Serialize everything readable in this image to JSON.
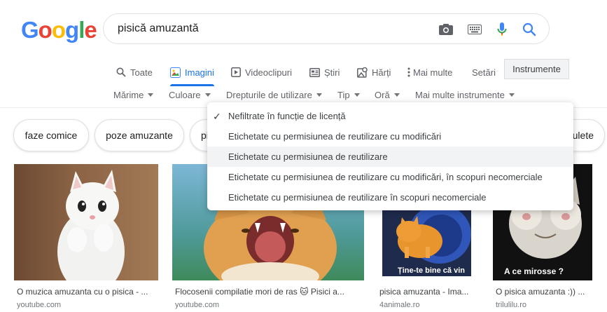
{
  "logo": {
    "letters": [
      "G",
      "o",
      "o",
      "g",
      "l",
      "e"
    ],
    "colors": [
      "#4285F4",
      "#EA4335",
      "#FBBC05",
      "#4285F4",
      "#34A853",
      "#EA4335"
    ]
  },
  "search": {
    "query": "pisică amuzantă"
  },
  "tabs": [
    {
      "label": "Toate",
      "icon": "search-icon"
    },
    {
      "label": "Imagini",
      "icon": "image-icon",
      "active": true
    },
    {
      "label": "Videoclipuri",
      "icon": "play-icon"
    },
    {
      "label": "Știri",
      "icon": "news-icon"
    },
    {
      "label": "Hărți",
      "icon": "map-icon"
    },
    {
      "label": "Mai multe",
      "icon": "more-icon"
    },
    {
      "label": "Setări"
    }
  ],
  "tools_label": "Instrumente",
  "filters": [
    "Mărime",
    "Culoare",
    "Drepturile de utilizare",
    "Tip",
    "Oră",
    "Mai multe instrumente"
  ],
  "chips": [
    "faze comice",
    "poze amuzante",
    "pi",
    "ulete"
  ],
  "usage_menu": [
    {
      "label": "Nefiltrate în funcție de licență",
      "checked": true
    },
    {
      "label": "Etichetate cu permisiunea de reutilizare cu modificări"
    },
    {
      "label": "Etichetate cu permisiunea de reutilizare",
      "hover": true
    },
    {
      "label": "Etichetate cu permisiunea de reutilizare cu modificări, în scopuri necomerciale"
    },
    {
      "label": "Etichetate cu permisiunea de reutilizare în scopuri necomerciale"
    }
  ],
  "results": [
    {
      "title": "O muzica amuzanta cu o pisica - ...",
      "source": "youtube.com"
    },
    {
      "title": "Flocosenii compilatie mori de ras 🐱 Pisici a...",
      "source": "youtube.com"
    },
    {
      "title": "pisica amuzanta - Ima...",
      "source": "4animale.ro",
      "caption": "Ține-te bine că vin"
    },
    {
      "title": "O pisica amuzanta :)) ...",
      "source": "trilulilu.ro",
      "caption": "A ce mirosse ?"
    }
  ],
  "colors": {
    "accent": "#1a73e8"
  }
}
